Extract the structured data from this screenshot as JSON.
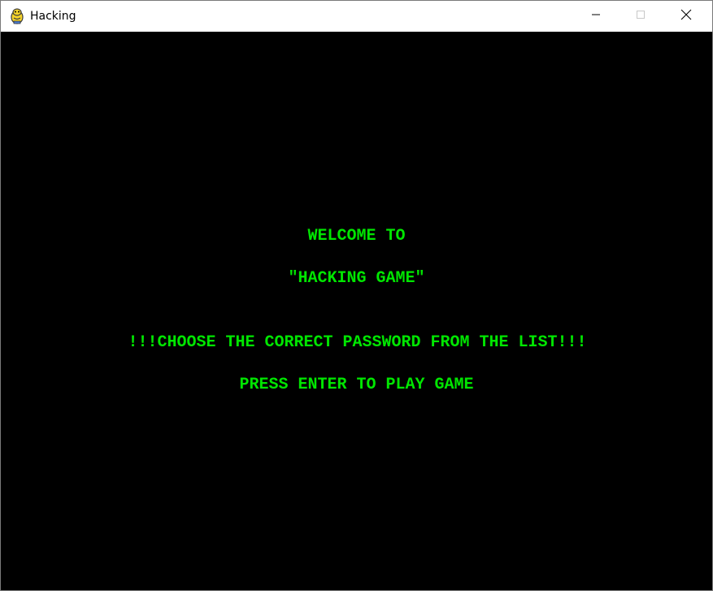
{
  "window": {
    "title": "Hacking",
    "icon": "pygame-snake-icon"
  },
  "controls": {
    "minimize_icon": "minimize-icon",
    "maximize_icon": "maximize-icon",
    "close_icon": "close-icon"
  },
  "game": {
    "background_color": "#000000",
    "text_color": "#00e600",
    "welcome_line": "WELCOME TO",
    "game_title_line": "\"HACKING GAME\"",
    "instruction_line": "!!!CHOOSE THE CORRECT PASSWORD FROM THE LIST!!!",
    "prompt_line": "PRESS ENTER TO PLAY GAME"
  }
}
